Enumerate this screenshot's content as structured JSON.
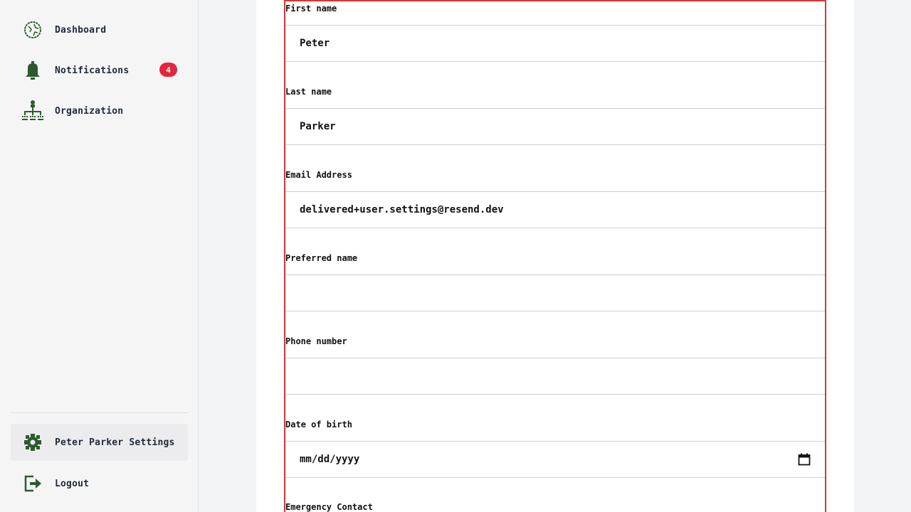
{
  "sidebar": {
    "items": [
      {
        "label": "Dashboard",
        "icon": "dashboard-icon"
      },
      {
        "label": "Notifications",
        "icon": "bell-icon",
        "badge": "4"
      },
      {
        "label": "Organization",
        "icon": "org-chart-icon"
      }
    ],
    "settings": {
      "label": "Peter Parker Settings",
      "icon": "gear-icon"
    },
    "logout": {
      "label": "Logout",
      "icon": "logout-icon"
    }
  },
  "form": {
    "first_name": {
      "label": "First name",
      "value": "Peter"
    },
    "last_name": {
      "label": "Last name",
      "value": "Parker"
    },
    "email": {
      "label": "Email Address",
      "value": "delivered+user.settings@resend.dev"
    },
    "preferred_name": {
      "label": "Preferred name",
      "value": ""
    },
    "phone": {
      "label": "Phone number",
      "value": ""
    },
    "dob": {
      "label": "Date of birth",
      "placeholder": "mm/dd/yyyy"
    },
    "emergency": {
      "label": "Emergency Contact"
    }
  },
  "colors": {
    "accent_green": "#2d5a2d",
    "badge_red": "#e5263a",
    "form_border": "#d93636"
  }
}
